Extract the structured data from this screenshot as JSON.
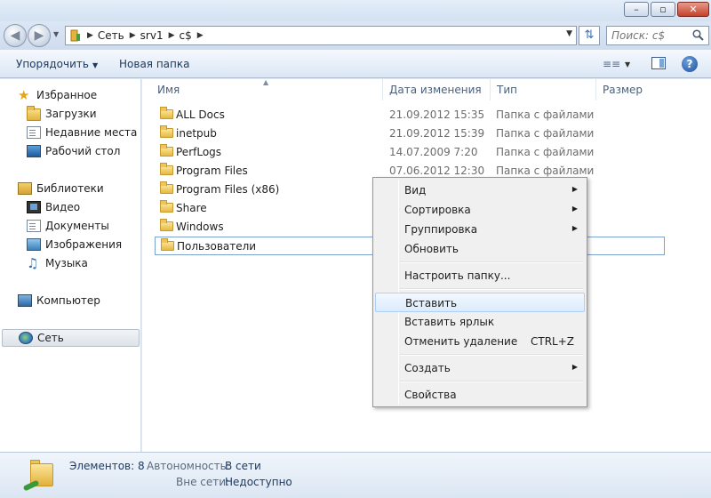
{
  "window": {
    "minimize_glyph": "–",
    "maximize_glyph": "▫",
    "close_glyph": "✕"
  },
  "address": {
    "breadcrumbs": [
      "Сеть",
      "srv1",
      "c$"
    ],
    "search_placeholder": "Поиск: c$"
  },
  "toolbar": {
    "organize_label": "Упорядочить",
    "new_folder_label": "Новая папка",
    "help_glyph": "?"
  },
  "nav": {
    "favorites": "Избранное",
    "favorites_items": [
      "Загрузки",
      "Недавние места",
      "Рабочий стол"
    ],
    "libraries": "Библиотеки",
    "libraries_items": [
      "Видео",
      "Документы",
      "Изображения",
      "Музыка"
    ],
    "computer": "Компьютер",
    "network": "Сеть"
  },
  "columns": {
    "name": "Имя",
    "modified": "Дата изменения",
    "type": "Тип",
    "size": "Размер"
  },
  "files": [
    {
      "name": "ALL Docs",
      "modified": "21.09.2012 15:35",
      "type": "Папка с файлами"
    },
    {
      "name": "inetpub",
      "modified": "21.09.2012 15:39",
      "type": "Папка с файлами"
    },
    {
      "name": "PerfLogs",
      "modified": "14.07.2009 7:20",
      "type": "Папка с файлами"
    },
    {
      "name": "Program Files",
      "modified": "07.06.2012 12:30",
      "type": "Папка с файлами"
    },
    {
      "name": "Program Files (x86)",
      "modified": "",
      "type": ""
    },
    {
      "name": "Share",
      "modified": "",
      "type": ""
    },
    {
      "name": "Windows",
      "modified": "",
      "type": ""
    },
    {
      "name": "Пользователи",
      "modified": "",
      "type": ""
    }
  ],
  "context_menu": {
    "view": "Вид",
    "sort": "Сортировка",
    "group": "Группировка",
    "refresh": "Обновить",
    "customize": "Настроить папку...",
    "paste": "Вставить",
    "paste_shortcut": "Вставить ярлык",
    "undo_delete": "Отменить удаление",
    "undo_shortcut": "CTRL+Z",
    "new": "Создать",
    "properties": "Свойства"
  },
  "details": {
    "count_label": "Элементов: 8",
    "offline_label": "Автономность:",
    "offline_value": "В сети",
    "network_label": "Вне сети:",
    "network_value": "Недоступно"
  }
}
